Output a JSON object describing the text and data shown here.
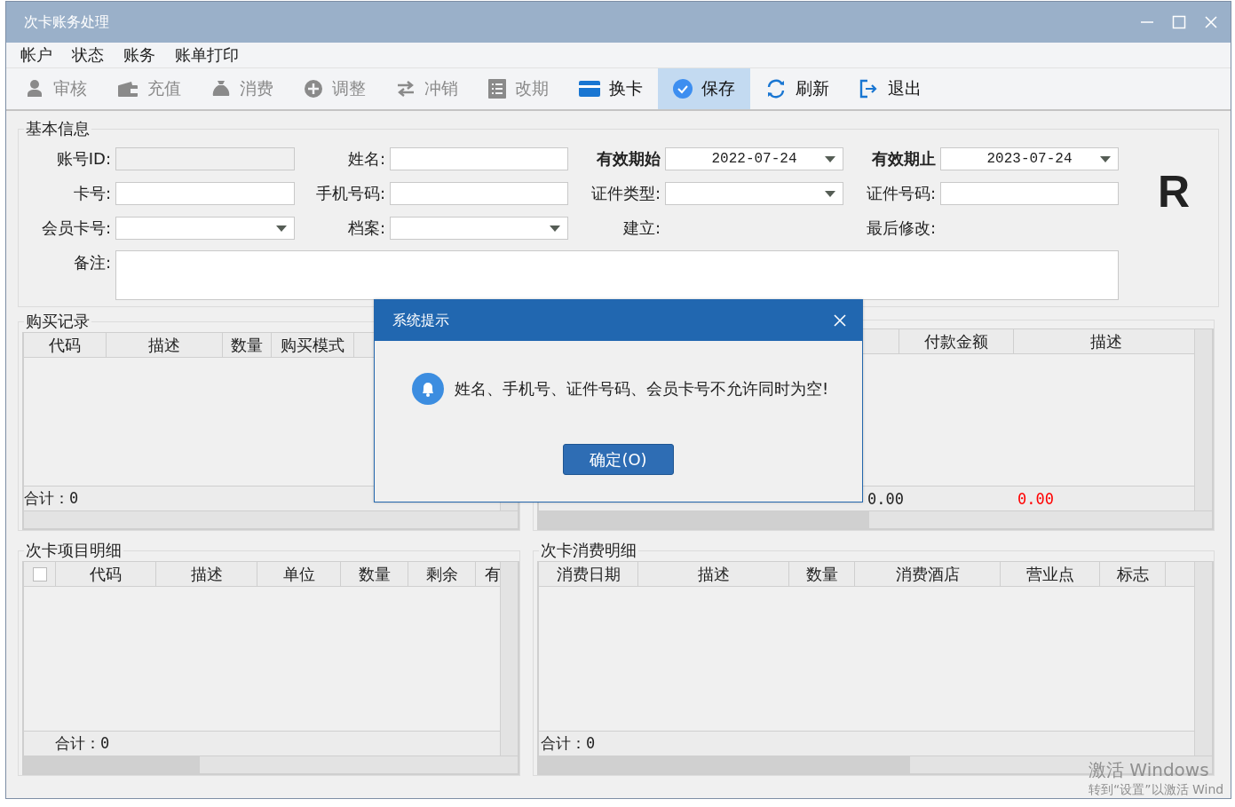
{
  "window": {
    "title": "次卡账务处理"
  },
  "menu": [
    "帐户",
    "状态",
    "账务",
    "账单打印"
  ],
  "toolbar": [
    {
      "label": "审核",
      "kind": "user",
      "disabled": true,
      "selected": false
    },
    {
      "label": "充值",
      "kind": "wallet",
      "disabled": true,
      "selected": false
    },
    {
      "label": "消费",
      "kind": "bag",
      "disabled": true,
      "selected": false
    },
    {
      "label": "调整",
      "kind": "plus",
      "disabled": true,
      "selected": false
    },
    {
      "label": "冲销",
      "kind": "swap",
      "disabled": true,
      "selected": false
    },
    {
      "label": "改期",
      "kind": "form",
      "disabled": true,
      "selected": false
    },
    {
      "label": "换卡",
      "kind": "card",
      "disabled": false,
      "selected": false
    },
    {
      "label": "保存",
      "kind": "check",
      "disabled": false,
      "selected": true
    },
    {
      "label": "刷新",
      "kind": "refresh",
      "disabled": false,
      "selected": false
    },
    {
      "label": "退出",
      "kind": "exit",
      "disabled": false,
      "selected": false
    }
  ],
  "basic_info": {
    "title": "基本信息",
    "mark_letter": "R",
    "rows": [
      [
        {
          "label": "账号ID:",
          "bold": false,
          "kind": "text",
          "disabled": true
        },
        {
          "label": "姓名:",
          "bold": false,
          "kind": "text",
          "disabled": false
        },
        {
          "label": "有效期始",
          "bold": true,
          "kind": "dropdown",
          "value": "2022-07-24"
        },
        {
          "label": "有效期止",
          "bold": true,
          "kind": "dropdown",
          "value": "2023-07-24"
        }
      ],
      [
        {
          "label": "卡号:",
          "bold": false,
          "kind": "text",
          "disabled": false
        },
        {
          "label": "手机号码:",
          "bold": false,
          "kind": "text",
          "disabled": false
        },
        {
          "label": "证件类型:",
          "bold": false,
          "kind": "dropdown"
        },
        {
          "label": "证件号码:",
          "bold": false,
          "kind": "text",
          "disabled": false
        }
      ],
      [
        {
          "label": "会员卡号:",
          "bold": false,
          "kind": "dropdown"
        },
        {
          "label": "档案:",
          "bold": false,
          "kind": "dropdown"
        },
        {
          "label": "建立:",
          "bold": false,
          "kind": "none"
        },
        {
          "label": "最后修改:",
          "bold": false,
          "kind": "none"
        }
      ],
      [
        {
          "label": "备注:",
          "bold": false,
          "kind": "memo"
        }
      ]
    ]
  },
  "panels": [
    {
      "title": "购买记录",
      "columns": [
        "代码",
        "描述",
        "数量",
        "购买模式"
      ],
      "totals": [
        {
          "text": "合计：0",
          "color": "#222222"
        }
      ]
    },
    {
      "columns": [
        "付款金额",
        "描述"
      ],
      "totals": [
        {
          "text": "0.00",
          "color": "#222222"
        },
        {
          "text": "0.00",
          "color": "#ff0000"
        }
      ]
    },
    {
      "title": "次卡项目明细",
      "select_all": {
        "checked": false
      },
      "columns": [
        "代码",
        "描述",
        "单位",
        "数量",
        "剩余",
        "有"
      ],
      "totals": [
        {
          "text": "合计：0",
          "color": "#222222"
        }
      ]
    },
    {
      "title": "次卡消费明细",
      "columns": [
        "消费日期",
        "描述",
        "数量",
        "消费酒店",
        "营业点",
        "标志"
      ],
      "totals": [
        {
          "text": "合计：0",
          "color": "#222222"
        }
      ]
    }
  ],
  "dialog": {
    "title": "系统提示",
    "message": "姓名、手机号、证件号码、会员卡号不允许同时为空!",
    "button": "确定(O)"
  },
  "activation_notice": {
    "title": "激活 Windows",
    "subtitle": "转到“设置”以激活 Wind"
  }
}
